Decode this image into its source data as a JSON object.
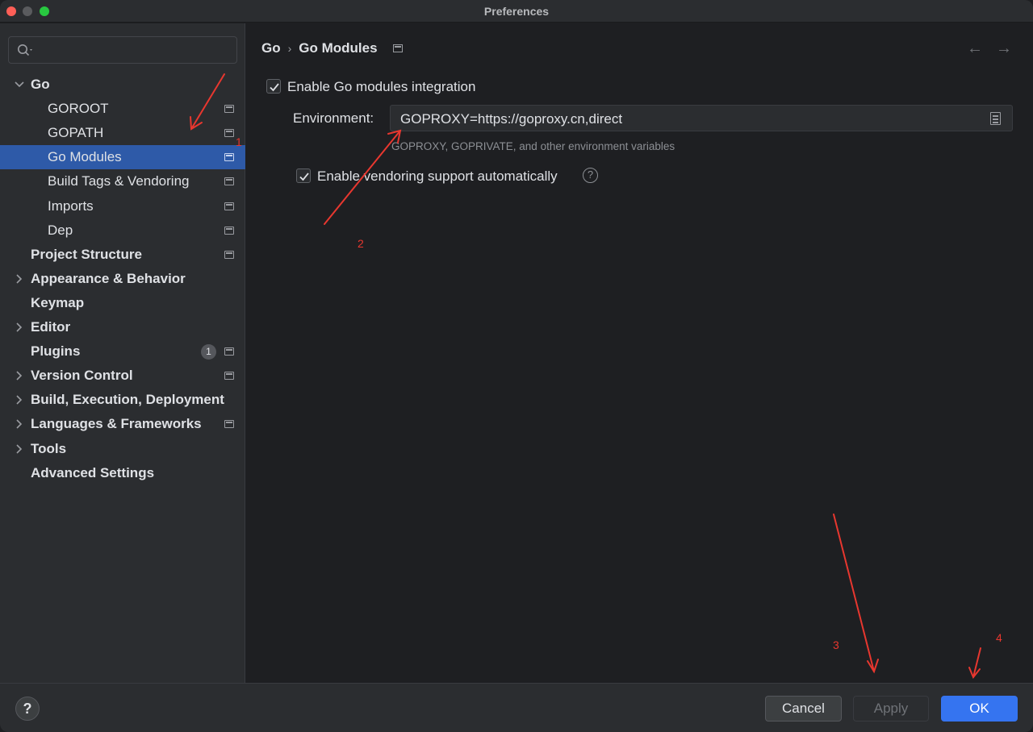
{
  "window": {
    "title": "Preferences"
  },
  "sidebar": {
    "search": {
      "placeholder": ""
    },
    "items": [
      {
        "label": "Go",
        "level": 0,
        "expandable": true,
        "expanded": true,
        "bold": true,
        "project_icon": false
      },
      {
        "label": "GOROOT",
        "level": 1,
        "project_icon": true
      },
      {
        "label": "GOPATH",
        "level": 1,
        "project_icon": true
      },
      {
        "label": "Go Modules",
        "level": 1,
        "project_icon": true,
        "selected": true
      },
      {
        "label": "Build Tags & Vendoring",
        "level": 1,
        "project_icon": true
      },
      {
        "label": "Imports",
        "level": 1,
        "project_icon": true
      },
      {
        "label": "Dep",
        "level": 1,
        "project_icon": true
      },
      {
        "label": "Project Structure",
        "level": 0,
        "bold": true,
        "project_icon": true
      },
      {
        "label": "Appearance & Behavior",
        "level": 0,
        "expandable": true,
        "bold": true
      },
      {
        "label": "Keymap",
        "level": 0,
        "bold": true
      },
      {
        "label": "Editor",
        "level": 0,
        "expandable": true,
        "bold": true
      },
      {
        "label": "Plugins",
        "level": 0,
        "bold": true,
        "badge": "1",
        "project_icon": true
      },
      {
        "label": "Version Control",
        "level": 0,
        "expandable": true,
        "bold": true,
        "project_icon": true
      },
      {
        "label": "Build, Execution, Deployment",
        "level": 0,
        "expandable": true,
        "bold": true
      },
      {
        "label": "Languages & Frameworks",
        "level": 0,
        "expandable": true,
        "bold": true,
        "project_icon": true
      },
      {
        "label": "Tools",
        "level": 0,
        "expandable": true,
        "bold": true
      },
      {
        "label": "Advanced Settings",
        "level": 0,
        "bold": true
      }
    ]
  },
  "main": {
    "breadcrumb": {
      "parent": "Go",
      "separator": "›",
      "current": "Go Modules"
    },
    "nav": {
      "back": "←",
      "forward": "→"
    },
    "enable_modules": {
      "label": "Enable Go modules integration",
      "checked": true
    },
    "environment": {
      "label": "Environment:",
      "value": "GOPROXY=https://goproxy.cn,direct",
      "hint": "GOPROXY, GOPRIVATE, and other environment variables"
    },
    "enable_vendoring": {
      "label": "Enable vendoring support automatically",
      "checked": true,
      "help": "?"
    }
  },
  "footer": {
    "help": "?",
    "cancel_label": "Cancel",
    "apply_label": "Apply",
    "ok_label": "OK"
  },
  "annotations": [
    "1",
    "2",
    "3",
    "4"
  ],
  "colors": {
    "accent": "#3574f0",
    "selection": "#2e5aa8",
    "annotation": "#e8372f"
  }
}
